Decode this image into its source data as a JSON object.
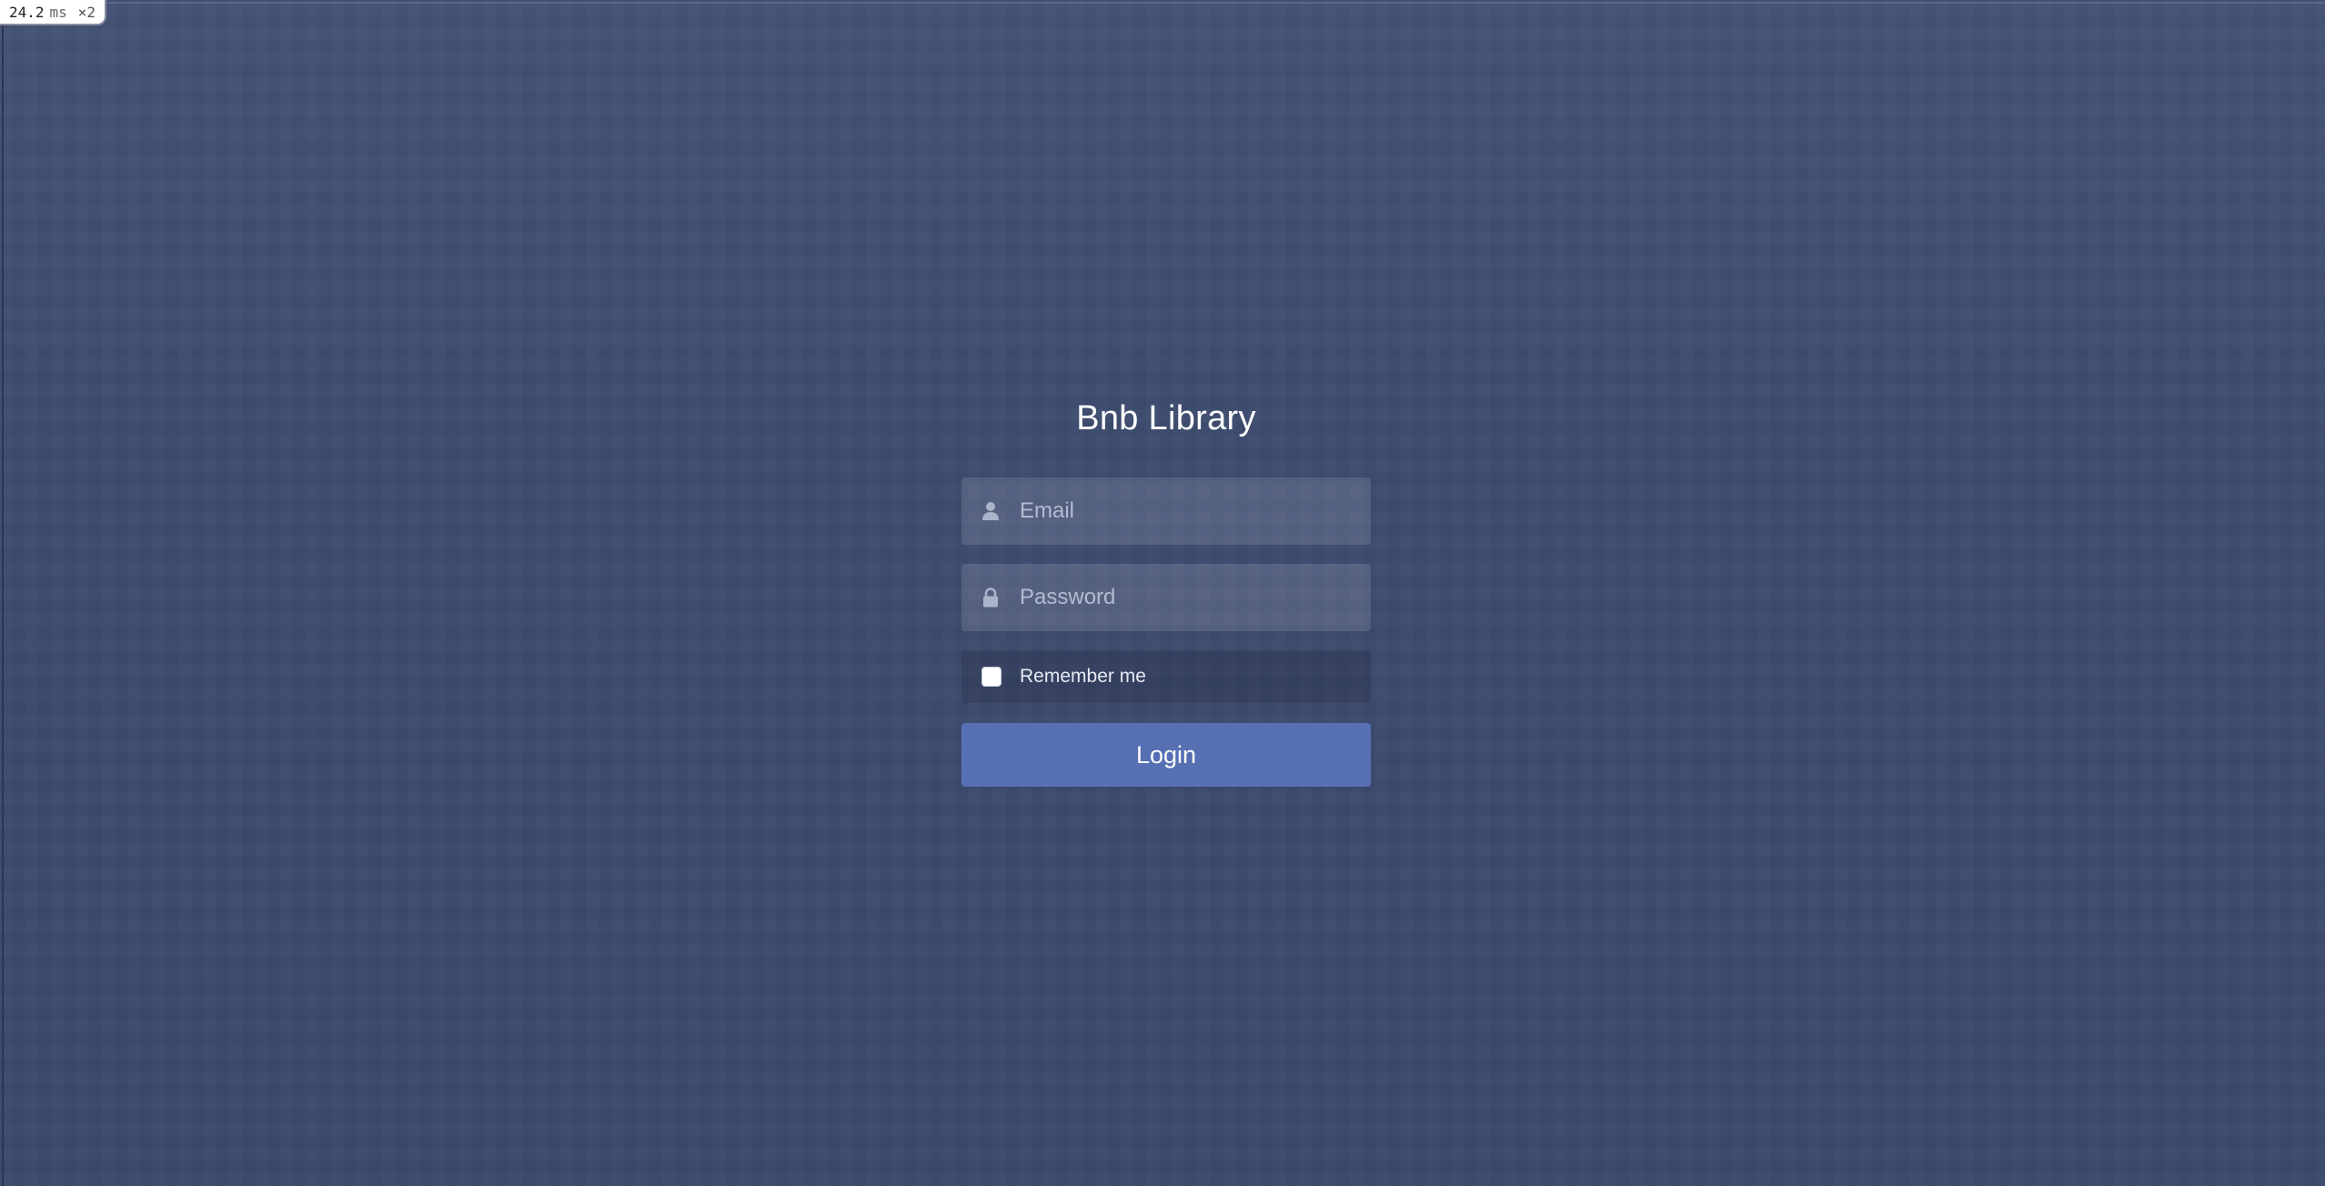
{
  "perf_badge": {
    "value": "24.2",
    "unit": "ms",
    "multiplier": "×2"
  },
  "app": {
    "title": "Bnb Library"
  },
  "form": {
    "email": {
      "placeholder": "Email",
      "value": "",
      "icon": "user-icon"
    },
    "password": {
      "placeholder": "Password",
      "value": "",
      "icon": "lock-icon"
    },
    "remember": {
      "label": "Remember me",
      "checked": false
    },
    "submit_label": "Login"
  },
  "colors": {
    "background": "#3d4b6e",
    "button": "#5670b3",
    "text": "#ffffff"
  }
}
